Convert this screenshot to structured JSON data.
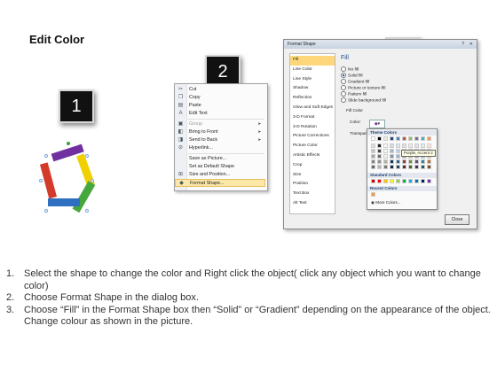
{
  "title": "Edit Color",
  "steps": [
    "1",
    "2",
    "3"
  ],
  "context_menu": {
    "items": [
      {
        "label": "Cut",
        "icon": "cut-icon"
      },
      {
        "label": "Copy",
        "icon": "copy-icon"
      },
      {
        "label": "Paste",
        "icon": "paste-icon"
      },
      {
        "label": "Edit Text",
        "icon": "edit-text-icon"
      },
      {
        "label": "Group",
        "icon": "group-icon",
        "submenu": true
      },
      {
        "label": "Bring to Front",
        "icon": "bring-to-front-icon",
        "submenu": true
      },
      {
        "label": "Send to Back",
        "icon": "send-to-back-icon",
        "submenu": true
      },
      {
        "label": "Hyperlink...",
        "icon": "hyperlink-icon"
      },
      {
        "label": "Save as Picture...",
        "icon": ""
      },
      {
        "label": "Set as Default Shape",
        "icon": ""
      },
      {
        "label": "Size and Position...",
        "icon": "size-icon"
      },
      {
        "label": "Format Shape...",
        "icon": "format-shape-icon"
      }
    ]
  },
  "dialog": {
    "title": "Format Shape",
    "close_label": "Close",
    "nav": [
      "Fill",
      "Line Color",
      "Line Style",
      "Shadow",
      "Reflection",
      "Glow and Soft Edges",
      "3-D Format",
      "3-D Rotation",
      "Picture Corrections",
      "Picture Color",
      "Artistic Effects",
      "Crop",
      "Size",
      "Position",
      "Text Box",
      "Alt Text"
    ],
    "fill_heading": "Fill",
    "fill_options": [
      "No fill",
      "Solid fill",
      "Gradient fill",
      "Picture or texture fill",
      "Pattern fill",
      "Slide background fill"
    ],
    "fill_color_label": "Fill Color",
    "color_label": "Color:",
    "transparency_label": "Transparency:"
  },
  "color_popup": {
    "theme_heading": "Theme Colors",
    "standard_heading": "Standard Colors",
    "recent_heading": "Recent Colors",
    "more_label": "More Colors...",
    "tooltip": "Purple, Accent 2",
    "theme_top": [
      "#ffffff",
      "#000000",
      "#eeece1",
      "#1f497d",
      "#4f81bd",
      "#c0504d",
      "#9bbb59",
      "#8064a2",
      "#4bacc6",
      "#f79646"
    ],
    "standard": [
      "#c00000",
      "#ff0000",
      "#ffc000",
      "#ffff00",
      "#92d050",
      "#00b050",
      "#00b0f0",
      "#0070c0",
      "#002060",
      "#7030a0"
    ],
    "recent": [
      "#f79646"
    ]
  },
  "instructions": [
    {
      "num": "1.",
      "text": "Select the shape to change the color and Right click the object( click any object which you want to change color)"
    },
    {
      "num": "2.",
      "text": "Choose Format Shape in the dialog box."
    },
    {
      "num": "3.",
      "text": "Choose “Fill” in the Format Shape box then “Solid” or “Gradient” depending on the appearance of the object. Change colour as shown in the picture."
    }
  ],
  "colors": {
    "shape_purple": "#7030a0",
    "shape_yellow": "#f0d000",
    "shape_green": "#46a83c",
    "shape_blue": "#2e6fc0",
    "shape_red": "#d43a2a",
    "selection": "#fdd77a"
  }
}
